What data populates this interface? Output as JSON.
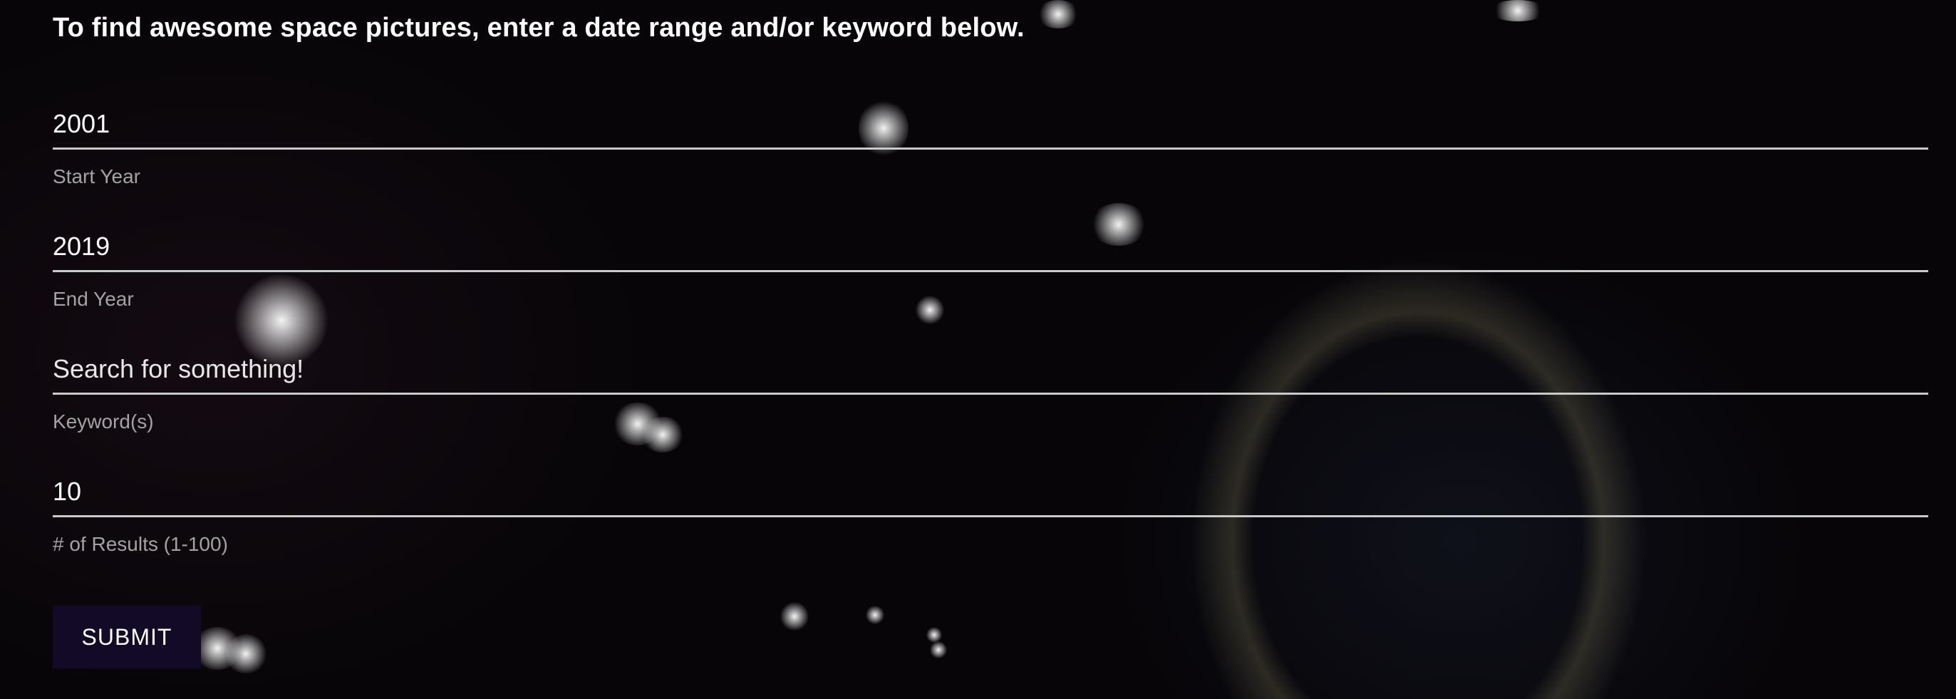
{
  "intro": {
    "text": "To find awesome space pictures, enter a date range and/or keyword below."
  },
  "form": {
    "start_year": {
      "value": "2001",
      "placeholder": "",
      "label": "Start Year"
    },
    "end_year": {
      "value": "2019",
      "placeholder": "",
      "label": "End Year"
    },
    "keywords": {
      "value": "",
      "placeholder": "Search for something!",
      "label": "Keyword(s)"
    },
    "num_results": {
      "value": "10",
      "placeholder": "",
      "label": "# of Results (1-100)"
    },
    "submit_label": "SUBMIT"
  },
  "colors": {
    "background": "#070508",
    "input_underline": "#c9c9c9",
    "label_text": "#a3a3a3",
    "button_bg": "#120a26"
  }
}
